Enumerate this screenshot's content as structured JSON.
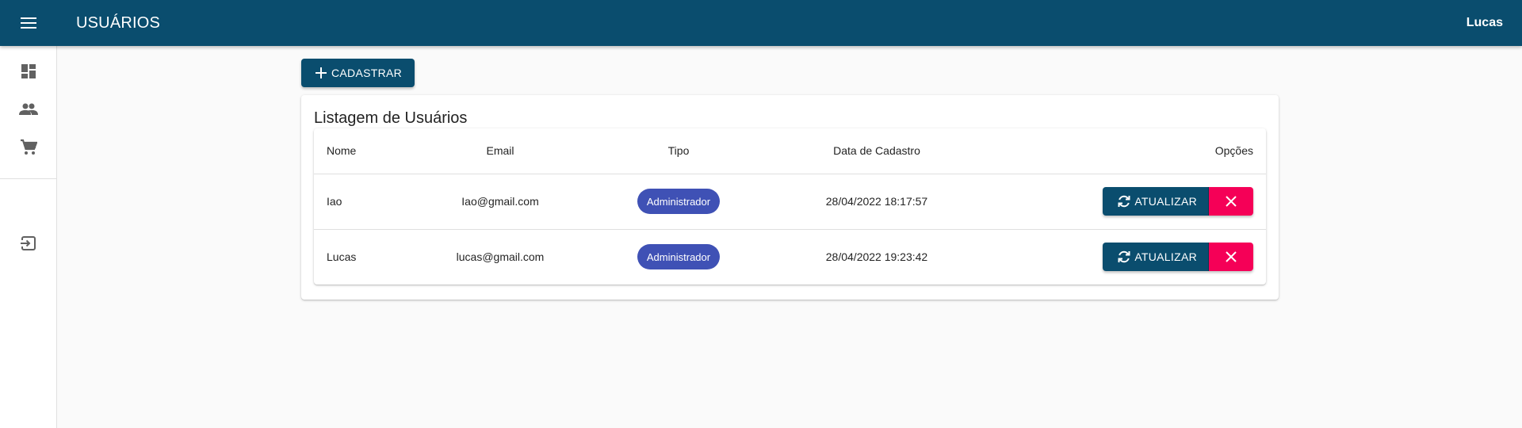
{
  "header": {
    "title": "USUÁRIOS",
    "user": "Lucas"
  },
  "sidebar": {
    "items": [
      {
        "name": "dashboard-icon"
      },
      {
        "name": "people-icon"
      },
      {
        "name": "cart-icon"
      }
    ],
    "logout_icon": "logout-icon"
  },
  "toolbar": {
    "add_label": "CADASTRAR"
  },
  "card": {
    "title": "Listagem de Usuários"
  },
  "table": {
    "headers": {
      "name": "Nome",
      "email": "Email",
      "tipo": "Tipo",
      "data": "Data de Cadastro",
      "opts": "Opções"
    },
    "rows": [
      {
        "name": "Iao",
        "email": "Iao@gmail.com",
        "tipo": "Administrador",
        "data": "28/04/2022 18:17:57",
        "update_label": "ATUALIZAR"
      },
      {
        "name": "Lucas",
        "email": "lucas@gmail.com",
        "tipo": "Administrador",
        "data": "28/04/2022 19:23:42",
        "update_label": "ATUALIZAR"
      }
    ]
  },
  "colors": {
    "primary": "#0a4d6e",
    "chip": "#3f51b5",
    "danger": "#f50057"
  }
}
